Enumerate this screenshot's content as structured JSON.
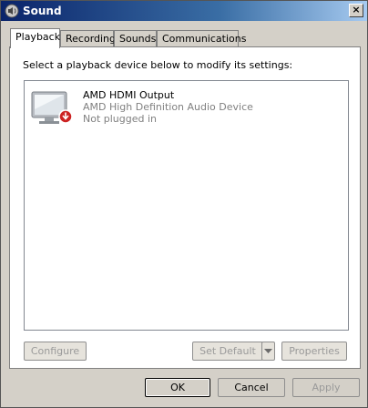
{
  "window": {
    "title": "Sound",
    "close_label": "×"
  },
  "tabs": [
    {
      "label": "Playback"
    },
    {
      "label": "Recording"
    },
    {
      "label": "Sounds"
    },
    {
      "label": "Communications"
    }
  ],
  "playback": {
    "instruction": "Select a playback device below to modify its settings:",
    "devices": [
      {
        "name": "AMD HDMI Output",
        "description": "AMD High Definition Audio Device",
        "status": "Not plugged in",
        "icon": "monitor-speaker-icon",
        "status_icon": "unplugged-red-arrow-icon"
      }
    ],
    "buttons": {
      "configure": "Configure",
      "set_default": "Set Default",
      "properties": "Properties"
    }
  },
  "footer": {
    "ok": "OK",
    "cancel": "Cancel",
    "apply": "Apply"
  },
  "colors": {
    "titlebar_start": "#0a246a",
    "titlebar_end": "#a6caf0",
    "status_red": "#cc2222"
  }
}
